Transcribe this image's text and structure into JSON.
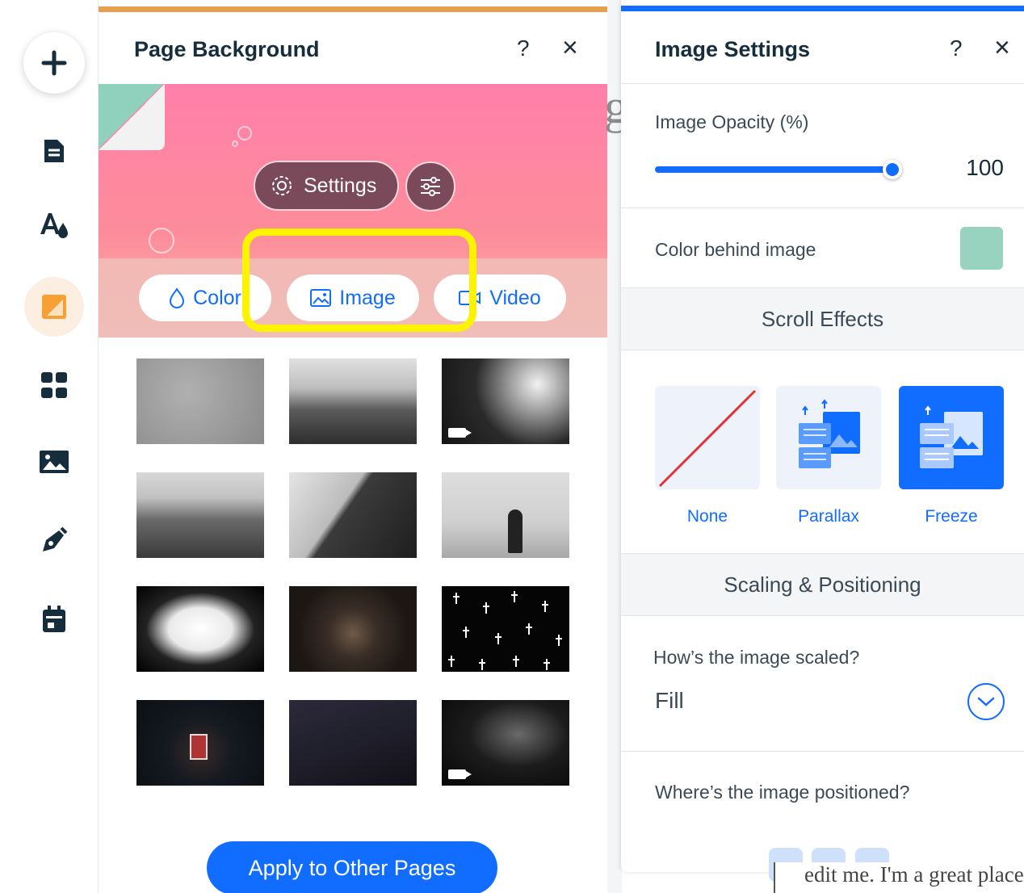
{
  "page_background": {
    "title": "Page Background",
    "help_label": "?",
    "close_label": "×",
    "settings_button": "Settings",
    "tabs": [
      {
        "label": "Color",
        "icon": "drop-icon"
      },
      {
        "label": "Image",
        "icon": "image-icon"
      },
      {
        "label": "Video",
        "icon": "video-icon"
      }
    ],
    "apply_button": "Apply to Other Pages"
  },
  "image_settings": {
    "title": "Image Settings",
    "help_label": "?",
    "close_label": "×",
    "opacity_label": "Image Opacity (%)",
    "opacity_value": "100",
    "opacity_fraction": 1.0,
    "color_behind_label": "Color behind image",
    "color_behind_value": "#97d3bf",
    "scroll_effects_header": "Scroll Effects",
    "effects": [
      {
        "label": "None",
        "selected": false
      },
      {
        "label": "Parallax",
        "selected": false
      },
      {
        "label": "Freeze",
        "selected": true
      }
    ],
    "scaling_header": "Scaling & Positioning",
    "scale_question": "How’s the image scaled?",
    "scale_value": "Fill",
    "position_question": "Where’s the image positioned?"
  },
  "canvas_text": {
    "glyph": "g",
    "body_snippet": "edit me. I'm a great place"
  },
  "colors": {
    "accent": "#116dff",
    "highlight": "#fbf300",
    "active_tool_bg": "#fdeee2",
    "active_tool": "#f7a135"
  }
}
